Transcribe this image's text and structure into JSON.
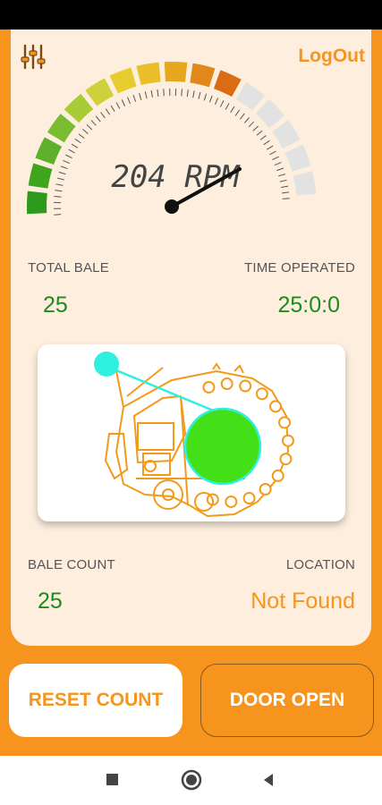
{
  "header": {
    "logout_label": "LogOut",
    "settings_icon": "sliders-icon"
  },
  "gauge": {
    "rpm_text": "204 RPM",
    "segments_total": 16,
    "segments_active": 11,
    "colors": {
      "active": [
        "#2e9a1c",
        "#3fa51f",
        "#5cb02a",
        "#79bc2f",
        "#a9cb35",
        "#cfd13a",
        "#e6cc2f",
        "#e8bf28",
        "#e6a61e",
        "#e2881a",
        "#d96c14",
        "#e39a6d"
      ],
      "inactive": "#e2e2e2"
    }
  },
  "stats": {
    "total_bale": {
      "label": "TOTAL BALE",
      "value": "25"
    },
    "time_operated": {
      "label": "TIME OPERATED",
      "value": "25:0:0"
    },
    "bale_count": {
      "label": "BALE COUNT",
      "value": "25"
    },
    "location": {
      "label": "LOCATION",
      "value": "Not Found"
    }
  },
  "buttons": {
    "reset": "RESET COUNT",
    "door": "DOOR OPEN"
  },
  "nav": {
    "recents": "square-icon",
    "home": "circle-icon",
    "back": "triangle-back-icon"
  },
  "colors": {
    "accent": "#f7941d",
    "panel": "#fdeedd",
    "value_green": "#1f8a1f",
    "bale_green": "#44e017",
    "arm_cyan": "#2ff0e0"
  }
}
